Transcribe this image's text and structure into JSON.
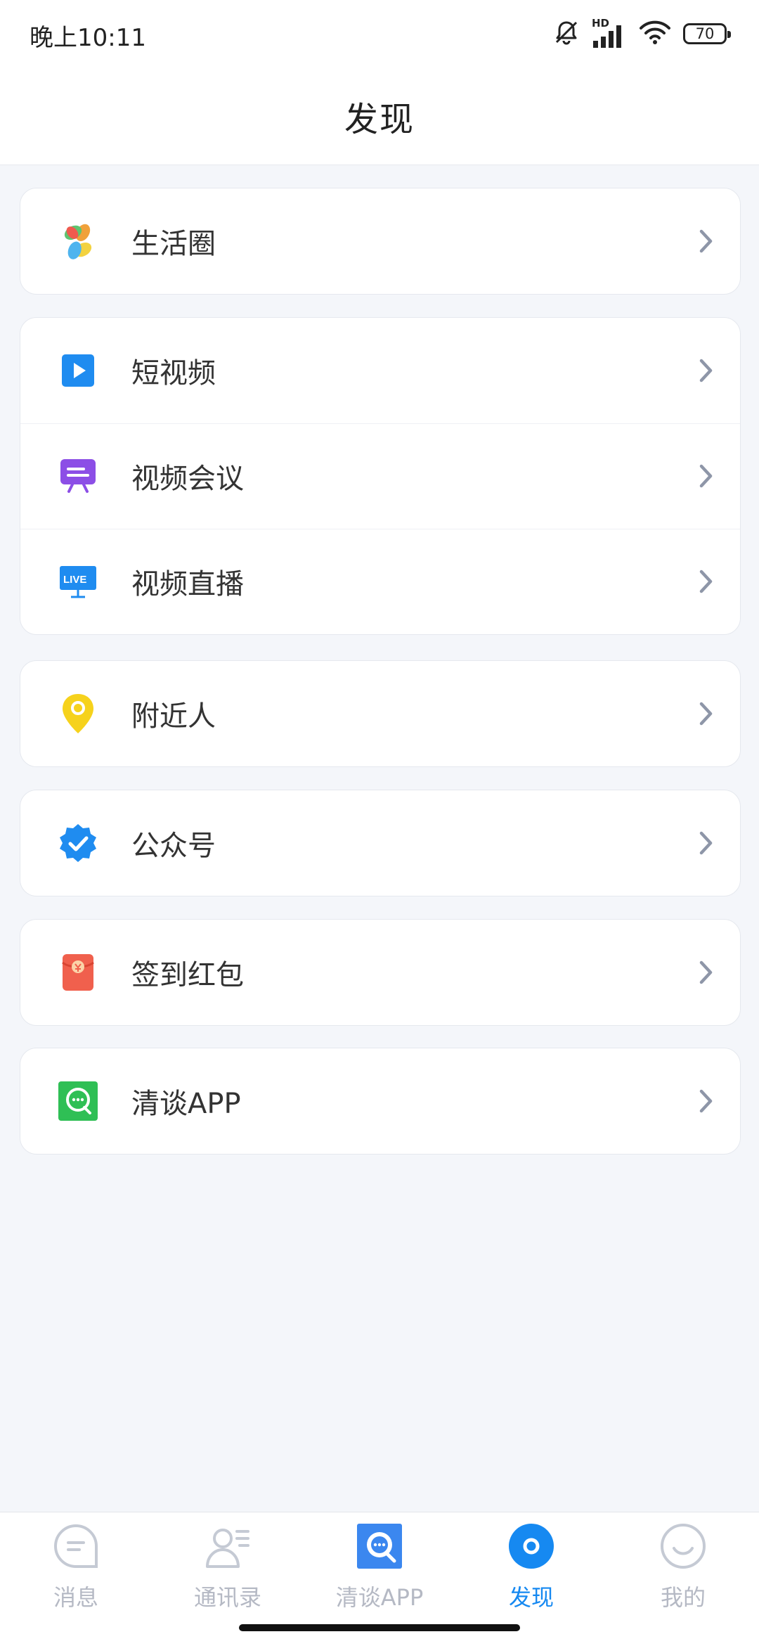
{
  "status_bar": {
    "time": "晚上10:11",
    "network_label": "HD",
    "battery_level": "70"
  },
  "header": {
    "title": "发现"
  },
  "menu": {
    "groups": [
      {
        "items": [
          {
            "label": "生活圈",
            "icon": "pinwheel-icon"
          }
        ]
      },
      {
        "items": [
          {
            "label": "短视频",
            "icon": "play-icon"
          },
          {
            "label": "视频会议",
            "icon": "presentation-icon"
          },
          {
            "label": "视频直播",
            "icon": "live-icon"
          }
        ]
      },
      {
        "items": [
          {
            "label": "附近人",
            "icon": "location-pin-icon"
          }
        ]
      },
      {
        "items": [
          {
            "label": "公众号",
            "icon": "verified-badge-icon"
          }
        ]
      },
      {
        "items": [
          {
            "label": "签到红包",
            "icon": "red-envelope-icon"
          }
        ]
      },
      {
        "items": [
          {
            "label": "清谈APP",
            "icon": "chat-bubble-icon"
          }
        ]
      }
    ]
  },
  "icon_labels": {
    "live": "LIVE"
  },
  "tabbar": {
    "tabs": [
      {
        "label": "消息",
        "icon": "message-icon"
      },
      {
        "label": "通讯录",
        "icon": "contacts-icon"
      },
      {
        "label": "清谈APP",
        "icon": "chat-app-icon"
      },
      {
        "label": "发现",
        "icon": "discover-icon",
        "active": true
      },
      {
        "label": "我的",
        "icon": "profile-icon"
      }
    ]
  },
  "colors": {
    "accent": "#1689f1",
    "inactive_tab": "#b5b9c4",
    "background": "#f4f6fa",
    "chevron": "#8e96a8"
  }
}
